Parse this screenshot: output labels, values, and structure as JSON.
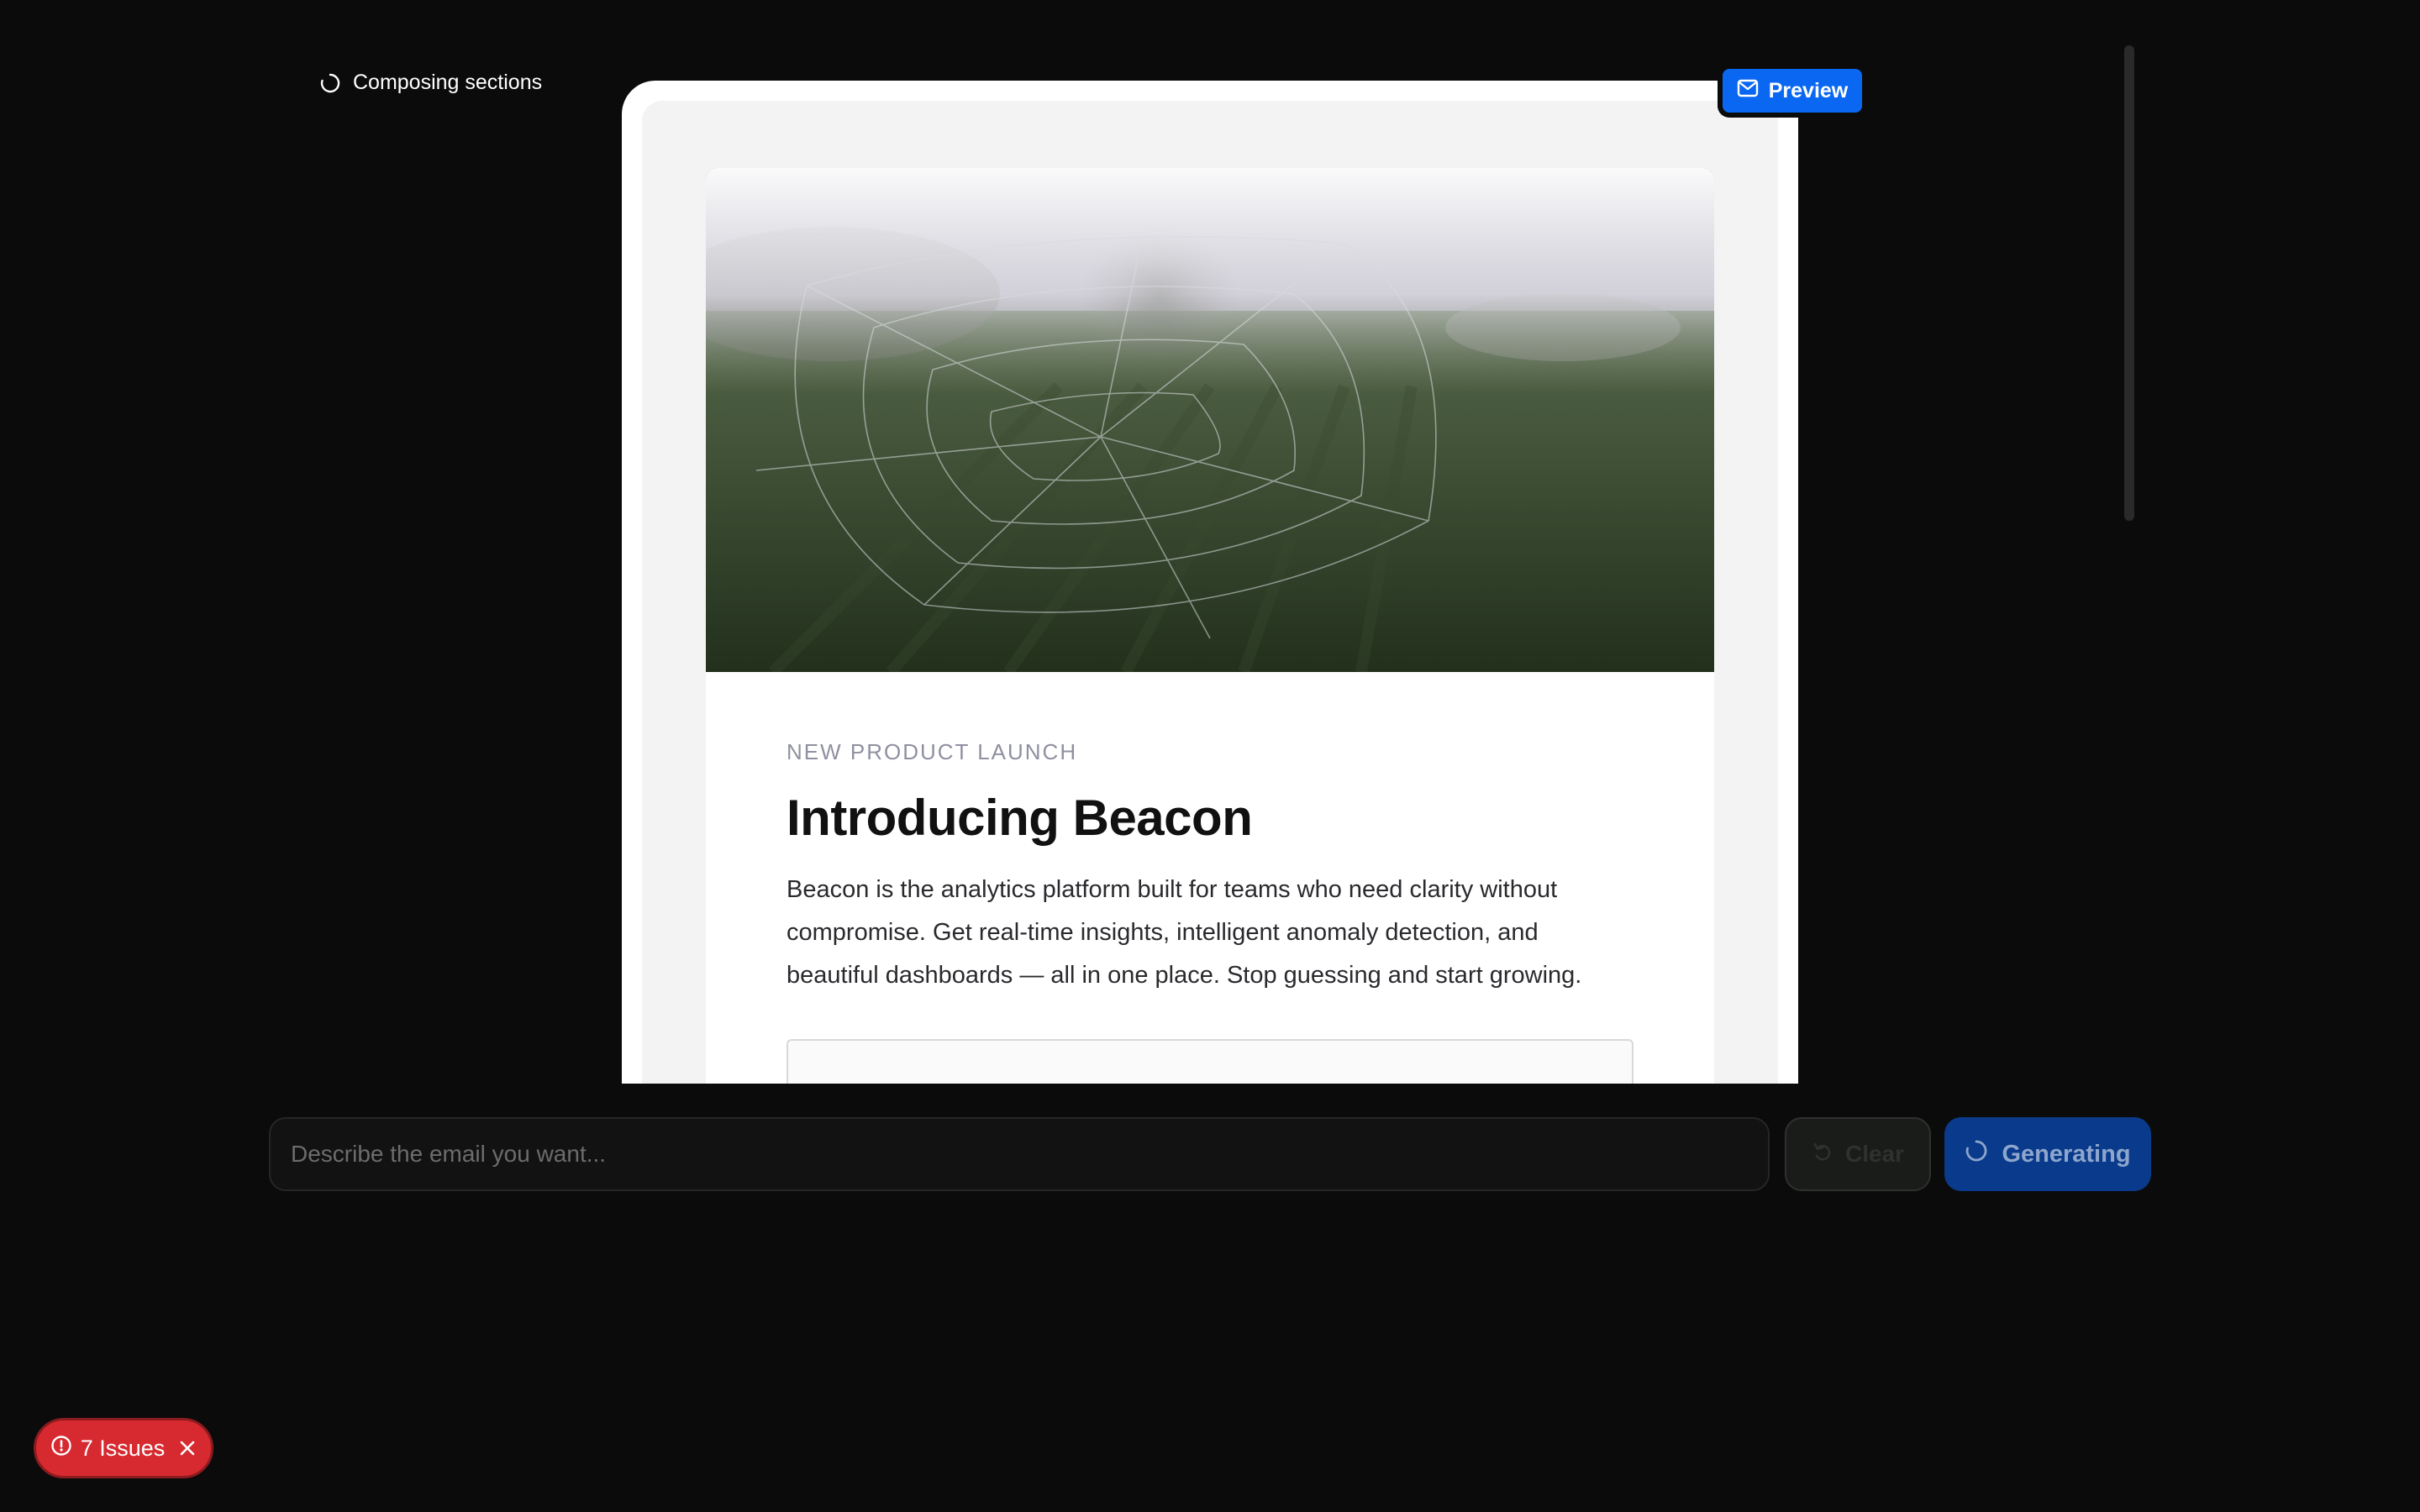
{
  "status": {
    "label": "Composing sections",
    "icon": "spinner-icon"
  },
  "preview_button": {
    "label": "Preview",
    "icon": "mail-icon",
    "color": "#0a67f2"
  },
  "email": {
    "hero_image": "misty-field-spiderweb-photo",
    "eyebrow": "NEW PRODUCT LAUNCH",
    "headline": "Introducing Beacon",
    "body": "Beacon is the analytics platform built for teams who need clarity without compromise. Get real-time insights, intelligent anomaly detection, and beautiful dashboards — all in one place. Stop guessing and start growing."
  },
  "composer": {
    "input_placeholder": "Describe the email you want...",
    "input_value": "",
    "clear_label": "Clear",
    "clear_icon": "undo-icon",
    "generate_label": "Generating",
    "generate_icon": "spinner-icon",
    "generate_color": "#0a3a8c"
  },
  "issues": {
    "label": "7 Issues",
    "icon": "alert-circle-icon",
    "close_icon": "close-icon",
    "color": "#d62a30"
  }
}
